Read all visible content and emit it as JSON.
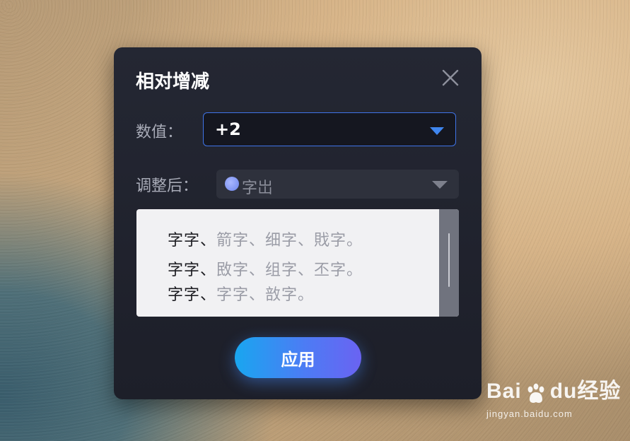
{
  "dialog": {
    "title": "相对增减",
    "value_label": "数值：",
    "value": "+2",
    "after_label": "调整后：",
    "after_value": "字岀",
    "preview_lines": [
      {
        "strong": "字字、",
        "muted": "箭字、细字、戝字。"
      },
      {
        "strong": "字字、",
        "muted": "敃字、组字、丕字。"
      },
      {
        "strong": "字字、",
        "muted": "字字、敨字。"
      }
    ],
    "apply_label": "应用"
  },
  "icons": {
    "close": "close-icon",
    "value_caret": "chevron-down-icon",
    "after_caret": "chevron-down-icon"
  },
  "colors": {
    "accent": "#3f74e8",
    "dialog_bg": "#1d1f29",
    "apply_start": "#19a6f0",
    "apply_end": "#6a63f2"
  },
  "watermark": {
    "brand_a": "Bai",
    "brand_b": "du",
    "brand_c": "经验",
    "url": "jingyan.baidu.com"
  }
}
